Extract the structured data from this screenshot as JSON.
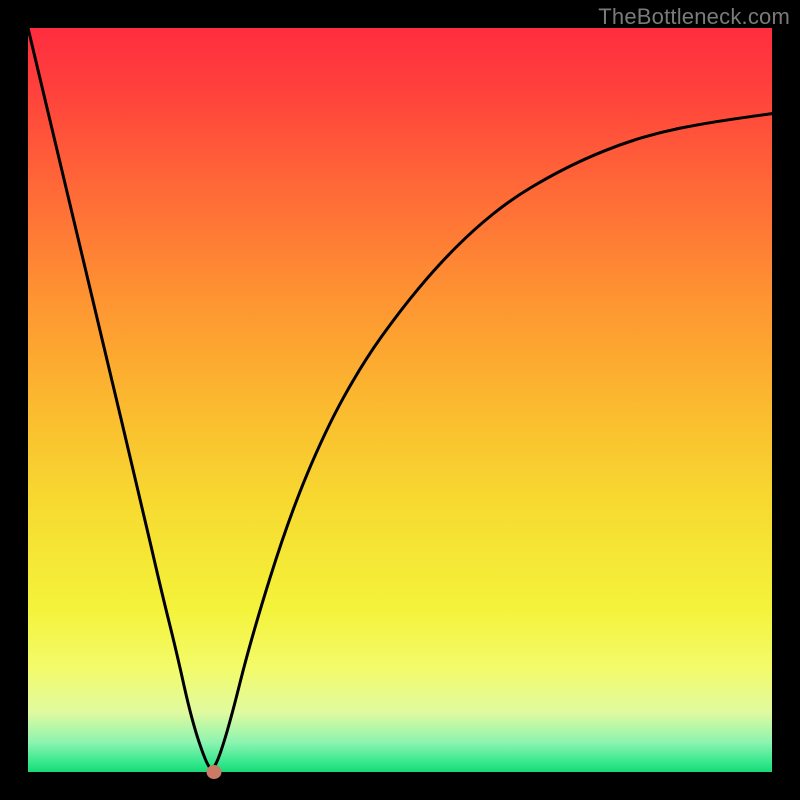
{
  "watermark": "TheBottleneck.com",
  "colors": {
    "frame": "#000000",
    "curve": "#000000",
    "marker": "#cb7a66"
  },
  "chart_data": {
    "type": "line",
    "title": "",
    "xlabel": "",
    "ylabel": "",
    "xlim": [
      0,
      100
    ],
    "ylim": [
      0,
      100
    ],
    "series": [
      {
        "name": "bottleneck-curve",
        "x": [
          0,
          5,
          10,
          15,
          18,
          20,
          22,
          24,
          25,
          27,
          30,
          35,
          40,
          45,
          50,
          55,
          60,
          65,
          70,
          75,
          80,
          85,
          90,
          95,
          100
        ],
        "y": [
          100,
          79,
          58,
          37,
          24,
          16,
          7,
          1,
          0,
          6,
          18,
          34,
          46,
          55,
          62,
          68,
          73,
          77,
          80,
          82.5,
          84.5,
          86,
          87,
          87.8,
          88.5
        ]
      }
    ],
    "marker": {
      "x": 25,
      "y": 0,
      "name": "optimal-point"
    },
    "background_gradient": {
      "stops": [
        {
          "pos": 0,
          "color": "#ff2d3f"
        },
        {
          "pos": 22,
          "color": "#ff6a37"
        },
        {
          "pos": 50,
          "color": "#fbb82f"
        },
        {
          "pos": 78,
          "color": "#f4f33a"
        },
        {
          "pos": 96,
          "color": "#8cf4b0"
        },
        {
          "pos": 100,
          "color": "#1ad676"
        }
      ]
    }
  }
}
